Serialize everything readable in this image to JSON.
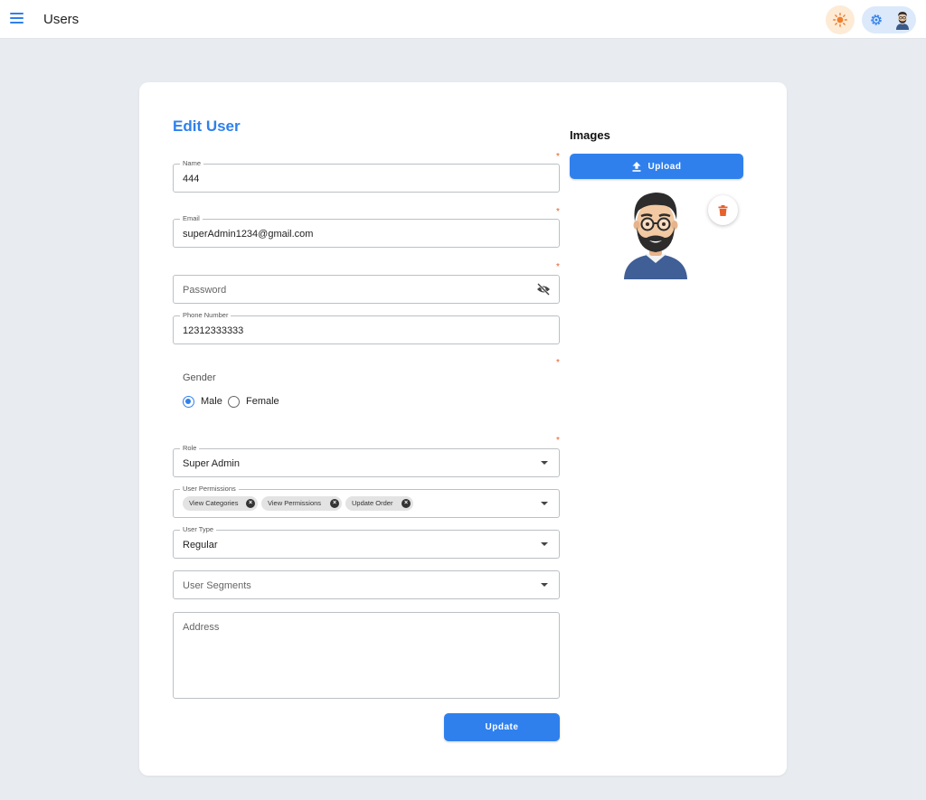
{
  "appbar": {
    "title": "Users",
    "menu_icon": "hamburger-menu-icon",
    "theme_icon": "sun-icon",
    "settings_icon": "gear-icon",
    "avatar_icon": "user-avatar-icon"
  },
  "form": {
    "title": "Edit User",
    "required_mark": "*",
    "name": {
      "label": "Name",
      "value": "444"
    },
    "email": {
      "label": "Email",
      "value": "superAdmin1234@gmail.com"
    },
    "password": {
      "placeholder": "Password",
      "icon": "eye-off-icon"
    },
    "phone": {
      "label": "Phone Number",
      "value": "12312333333"
    },
    "gender": {
      "label": "Gender",
      "options": [
        {
          "label": "Male",
          "checked": true
        },
        {
          "label": "Female",
          "checked": false
        }
      ]
    },
    "role": {
      "label": "Role",
      "value": "Super Admin"
    },
    "permissions": {
      "label": "User Permissions",
      "chips": [
        "View Categories",
        "View Permissions",
        "Update Order"
      ],
      "chip_remove": "×"
    },
    "user_type": {
      "label": "User Type",
      "value": "Regular"
    },
    "user_segments": {
      "placeholder": "User Segments"
    },
    "address": {
      "placeholder": "Address"
    },
    "update_label": "Update"
  },
  "images": {
    "title": "Images",
    "upload_label": "Upload",
    "upload_icon": "upload-icon",
    "delete_icon": "trash-icon"
  },
  "colors": {
    "accent": "#2f80ed",
    "required": "#e35d2c",
    "background": "#e8ecf0",
    "delete": "#e8602c"
  }
}
